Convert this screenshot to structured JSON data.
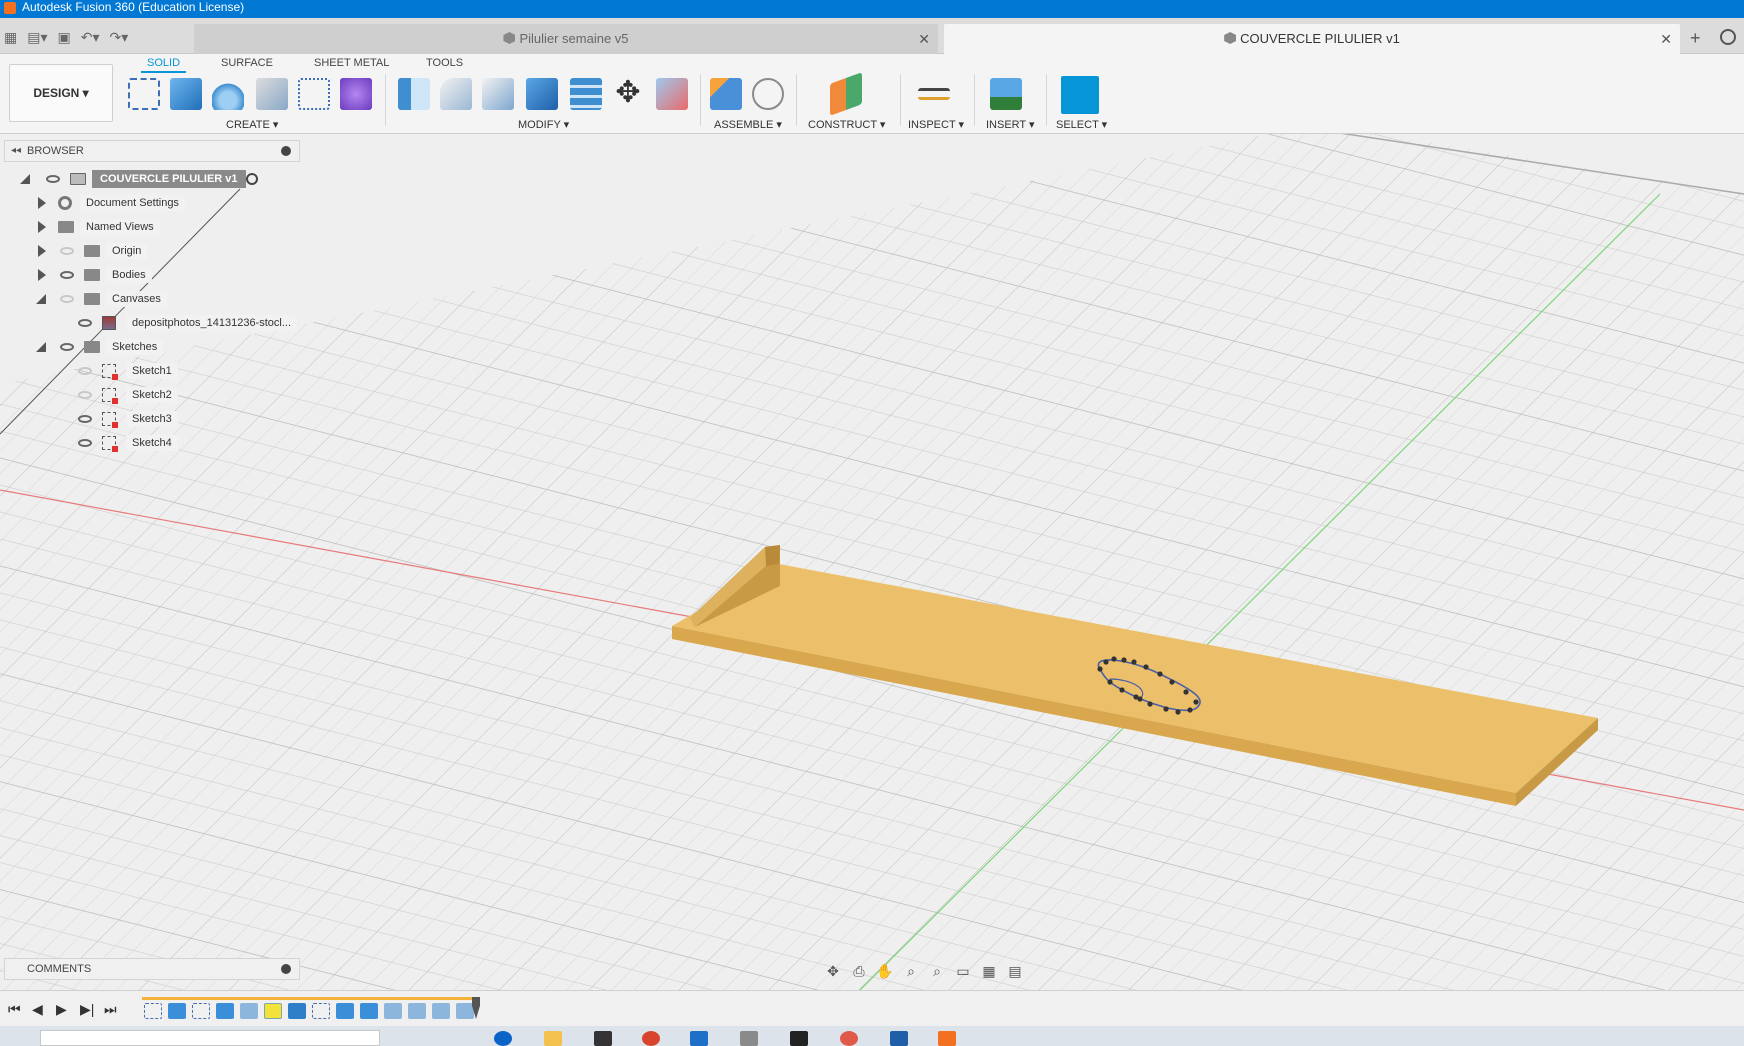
{
  "window": {
    "title": "Autodesk Fusion 360 (Education License)"
  },
  "tabs": [
    {
      "label": "Pilulier semaine v5",
      "active": false
    },
    {
      "label": "COUVERCLE PILULIER v1",
      "active": true
    }
  ],
  "workspace": {
    "label": "DESIGN ▾"
  },
  "toolbar_tabs": [
    "SOLID",
    "SURFACE",
    "SHEET METAL",
    "TOOLS"
  ],
  "tool_groups": [
    "CREATE ▾",
    "MODIFY ▾",
    "ASSEMBLE ▾",
    "CONSTRUCT ▾",
    "INSPECT ▾",
    "INSERT ▾",
    "SELECT ▾"
  ],
  "browser": {
    "title": "BROWSER",
    "root": "COUVERCLE PILULIER v1",
    "items": [
      {
        "label": "Document Settings"
      },
      {
        "label": "Named Views"
      },
      {
        "label": "Origin"
      },
      {
        "label": "Bodies"
      },
      {
        "label": "Canvases"
      },
      {
        "label": "depositphotos_14131236-stocl..."
      },
      {
        "label": "Sketches"
      },
      {
        "label": "Sketch1"
      },
      {
        "label": "Sketch2"
      },
      {
        "label": "Sketch3"
      },
      {
        "label": "Sketch4"
      }
    ]
  },
  "comments": {
    "title": "COMMENTS"
  },
  "colors": {
    "titlebar": "#0078d4",
    "accent": "#0696d7",
    "body_top": "#ecc06a",
    "body_side": "#d9a84e",
    "x_axis": "#e87a7a",
    "y_axis": "#7ad67a",
    "timeline_bar": "#f3b23a"
  }
}
